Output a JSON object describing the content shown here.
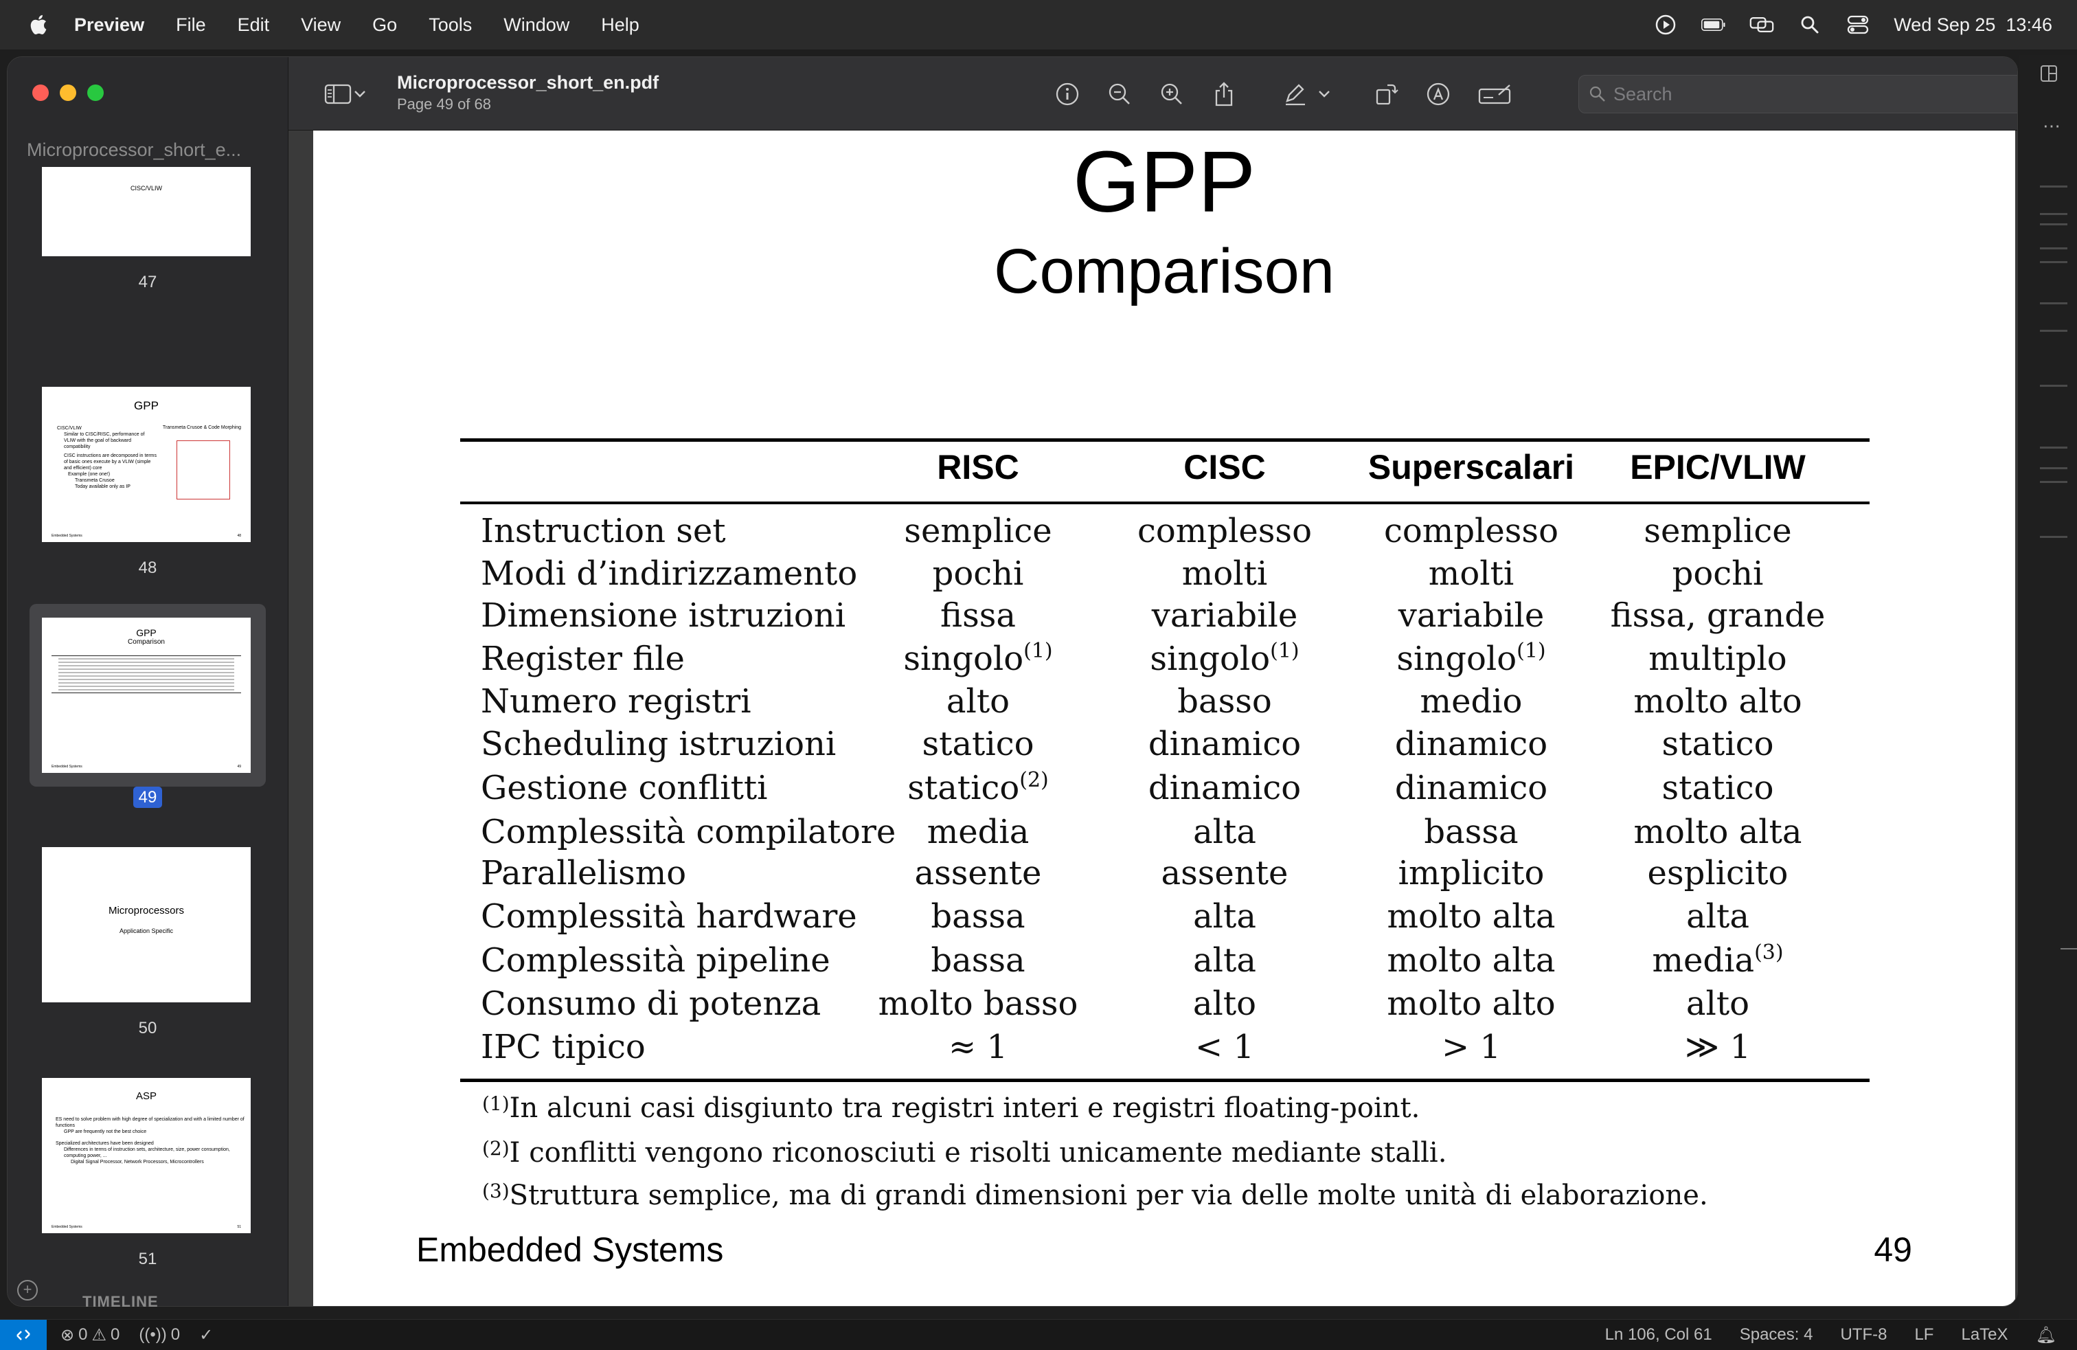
{
  "menubar": {
    "app": "Preview",
    "items": [
      "File",
      "Edit",
      "View",
      "Go",
      "Tools",
      "Window",
      "Help"
    ],
    "datetime": "Wed Sep 25  13:46"
  },
  "sidebar": {
    "doc_tab": "Microprocessor_short_e...",
    "pages": [
      {
        "num": "47",
        "title": "",
        "subtitle": "CISC/VLIW"
      },
      {
        "num": "48",
        "title": "GPP",
        "subtitle": "Transmeta Crusoe & Code Morphing"
      },
      {
        "num": "49",
        "title": "GPP",
        "subtitle": "Comparison"
      },
      {
        "num": "50",
        "title": "Microprocessors",
        "subtitle": "Application Specific"
      },
      {
        "num": "51",
        "title": "ASP",
        "subtitle": ""
      }
    ],
    "thumb48_bullets": [
      "CISC/VLIW",
      "Similar to CISC/RISC, performance of VLIW with the goal of backward compatibility",
      "CISC instructions are decomposed in terms of basic ones execute by a VLIW (simple and efficient) core",
      "Example (one one!)",
      "Transmeta Crusoe",
      "Today available only as IP"
    ],
    "thumb51_bullets": [
      "ES need to solve problem with high degree of specialization and with a limited number of functions",
      "GPP are frequently not the best choice",
      "Specialized architectures have been designed",
      "Differences in terms of instruction sets, architecture, size, power consumption, computing power, ...",
      "Digital Signal Processor, Network Processors, Microcontrollers"
    ],
    "thumb_footer": "Embedded Systems"
  },
  "toolbar": {
    "title": "Microprocessor_short_en.pdf",
    "subtitle": "Page 49 of 68",
    "search_placeholder": "Search"
  },
  "page": {
    "title": "GPP",
    "subtitle": "Comparison",
    "columns": [
      "RISC",
      "CISC",
      "Superscalari",
      "EPIC/VLIW"
    ],
    "rows": [
      {
        "label": "Instruction set",
        "cells": [
          "semplice",
          "complesso",
          "complesso",
          "semplice"
        ],
        "sups": [
          "",
          "",
          "",
          ""
        ]
      },
      {
        "label": "Modi d’indirizzamento",
        "cells": [
          "pochi",
          "molti",
          "molti",
          "pochi"
        ],
        "sups": [
          "",
          "",
          "",
          ""
        ]
      },
      {
        "label": "Dimensione istruzioni",
        "cells": [
          "fissa",
          "variabile",
          "variabile",
          "fissa, grande"
        ],
        "sups": [
          "",
          "",
          "",
          ""
        ]
      },
      {
        "label": "Register file",
        "cells": [
          "singolo",
          "singolo",
          "singolo",
          "multiplo"
        ],
        "sups": [
          "(1)",
          "(1)",
          "(1)",
          ""
        ]
      },
      {
        "label": "Numero registri",
        "cells": [
          "alto",
          "basso",
          "medio",
          "molto alto"
        ],
        "sups": [
          "",
          "",
          "",
          ""
        ]
      },
      {
        "label": "Scheduling istruzioni",
        "cells": [
          "statico",
          "dinamico",
          "dinamico",
          "statico"
        ],
        "sups": [
          "",
          "",
          "",
          ""
        ]
      },
      {
        "label": "Gestione conflitti",
        "cells": [
          "statico",
          "dinamico",
          "dinamico",
          "statico"
        ],
        "sups": [
          "(2)",
          "",
          "",
          ""
        ]
      },
      {
        "label": "Complessità compilatore",
        "cells": [
          "media",
          "alta",
          "bassa",
          "molto alta"
        ],
        "sups": [
          "",
          "",
          "",
          ""
        ]
      },
      {
        "label": "Parallelismo",
        "cells": [
          "assente",
          "assente",
          "implicito",
          "esplicito"
        ],
        "sups": [
          "",
          "",
          "",
          ""
        ]
      },
      {
        "label": "Complessità hardware",
        "cells": [
          "bassa",
          "alta",
          "molto alta",
          "alta"
        ],
        "sups": [
          "",
          "",
          "",
          ""
        ]
      },
      {
        "label": "Complessità pipeline",
        "cells": [
          "bassa",
          "alta",
          "molto alta",
          "media"
        ],
        "sups": [
          "",
          "",
          "",
          "(3)"
        ]
      },
      {
        "label": "Consumo di potenza",
        "cells": [
          "molto basso",
          "alto",
          "molto alto",
          "alto"
        ],
        "sups": [
          "",
          "",
          "",
          ""
        ]
      },
      {
        "label": "IPC tipico",
        "cells": [
          "≈ 1",
          "< 1",
          "> 1",
          "≫ 1"
        ],
        "sups": [
          "",
          "",
          "",
          ""
        ]
      }
    ],
    "footnotes": [
      {
        "mark": "(1)",
        "text": "In alcuni casi disgiunto tra registri interi e registri floating-point."
      },
      {
        "mark": "(2)",
        "text": "I conflitti vengono riconosciuti e risolti unicamente mediante stalli."
      },
      {
        "mark": "(3)",
        "text": "Struttura semplice, ma di grandi dimensioni per via delle molte unità di elaborazione."
      }
    ],
    "footer": "Embedded Systems",
    "page_number": "49"
  },
  "statusbar": {
    "errors": "0",
    "warnings": "0",
    "ports": "0",
    "position": "Ln 106, Col 61",
    "spaces": "Spaces: 4",
    "encoding": "UTF-8",
    "eol": "LF",
    "language": "LaTeX"
  },
  "timeline": "TIMELINE",
  "colors": {
    "selection": "#2f62d3",
    "remote_button": "#0078d4",
    "traffic_close": "#ff5f57",
    "traffic_min": "#febc2e",
    "traffic_max": "#28c840"
  }
}
